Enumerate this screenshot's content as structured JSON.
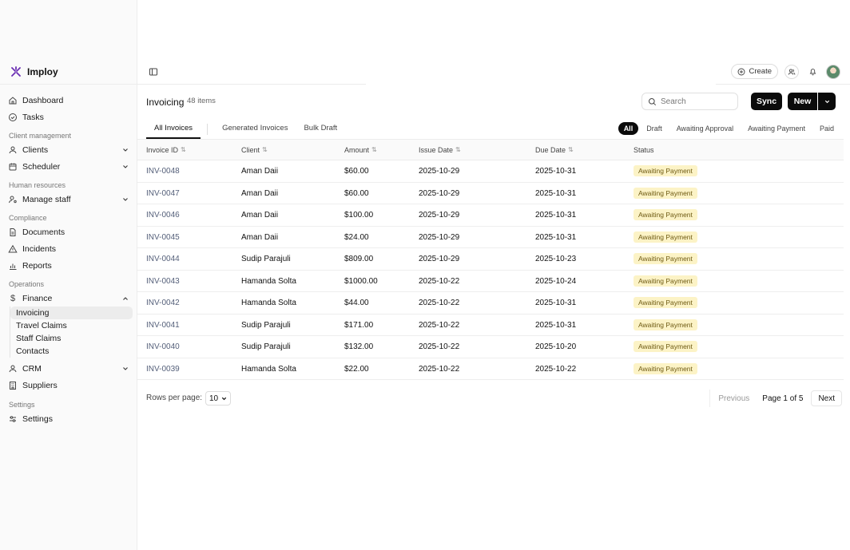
{
  "app": {
    "name": "Imploy"
  },
  "sidebar": {
    "top_items": [
      {
        "label": "Dashboard",
        "icon": "home-icon"
      },
      {
        "label": "Tasks",
        "icon": "check-circle-icon"
      }
    ],
    "sections": {
      "client_management": "Client management",
      "human_resources": "Human resources",
      "compliance": "Compliance",
      "operations": "Operations",
      "settings": "Settings"
    },
    "items": {
      "clients": "Clients",
      "scheduler": "Scheduler",
      "manage_staff": "Manage staff",
      "documents": "Documents",
      "incidents": "Incidents",
      "reports": "Reports",
      "finance": "Finance",
      "crm": "CRM",
      "suppliers": "Suppliers",
      "settings": "Settings"
    },
    "finance_sub": [
      "Invoicing",
      "Travel Claims",
      "Staff Claims",
      "Contacts"
    ]
  },
  "topbar": {
    "create_label": "Create"
  },
  "header": {
    "title": "Invoicing",
    "count": "48 items",
    "search_placeholder": "Search",
    "sync_label": "Sync",
    "new_label": "New"
  },
  "tabs": [
    "All Invoices",
    "Generated Invoices",
    "Bulk Draft"
  ],
  "filters": [
    "All",
    "Draft",
    "Awaiting Approval",
    "Awaiting Payment",
    "Paid"
  ],
  "table": {
    "columns": [
      "Invoice ID",
      "Client",
      "Amount",
      "Issue Date",
      "Due Date",
      "Status"
    ],
    "rows": [
      [
        "INV-0048",
        "Aman Daii",
        "$60.00",
        "2025-10-29",
        "2025-10-31",
        "Awaiting Payment"
      ],
      [
        "INV-0047",
        "Aman Daii",
        "$60.00",
        "2025-10-29",
        "2025-10-31",
        "Awaiting Payment"
      ],
      [
        "INV-0046",
        "Aman Daii",
        "$100.00",
        "2025-10-29",
        "2025-10-31",
        "Awaiting Payment"
      ],
      [
        "INV-0045",
        "Aman Daii",
        "$24.00",
        "2025-10-29",
        "2025-10-31",
        "Awaiting Payment"
      ],
      [
        "INV-0044",
        "Sudip Parajuli",
        "$809.00",
        "2025-10-29",
        "2025-10-23",
        "Awaiting Payment"
      ],
      [
        "INV-0043",
        "Hamanda Solta",
        "$1000.00",
        "2025-10-22",
        "2025-10-24",
        "Awaiting Payment"
      ],
      [
        "INV-0042",
        "Hamanda Solta",
        "$44.00",
        "2025-10-22",
        "2025-10-31",
        "Awaiting Payment"
      ],
      [
        "INV-0041",
        "Sudip Parajuli",
        "$171.00",
        "2025-10-22",
        "2025-10-31",
        "Awaiting Payment"
      ],
      [
        "INV-0040",
        "Sudip Parajuli",
        "$132.00",
        "2025-10-22",
        "2025-10-20",
        "Awaiting Payment"
      ],
      [
        "INV-0039",
        "Hamanda Solta",
        "$22.00",
        "2025-10-22",
        "2025-10-22",
        "Awaiting Payment"
      ]
    ]
  },
  "pagination": {
    "rows_label": "Rows per page:",
    "rows_value": "10",
    "prev_label": "Previous",
    "page_info": "Page 1 of 5",
    "next_label": "Next"
  },
  "colors": {
    "accent": "#0b0b0b",
    "badge_bg": "#fcf3c6",
    "badge_text": "#6e5a12",
    "link": "#55607a",
    "logo": "#6b2fb3"
  }
}
